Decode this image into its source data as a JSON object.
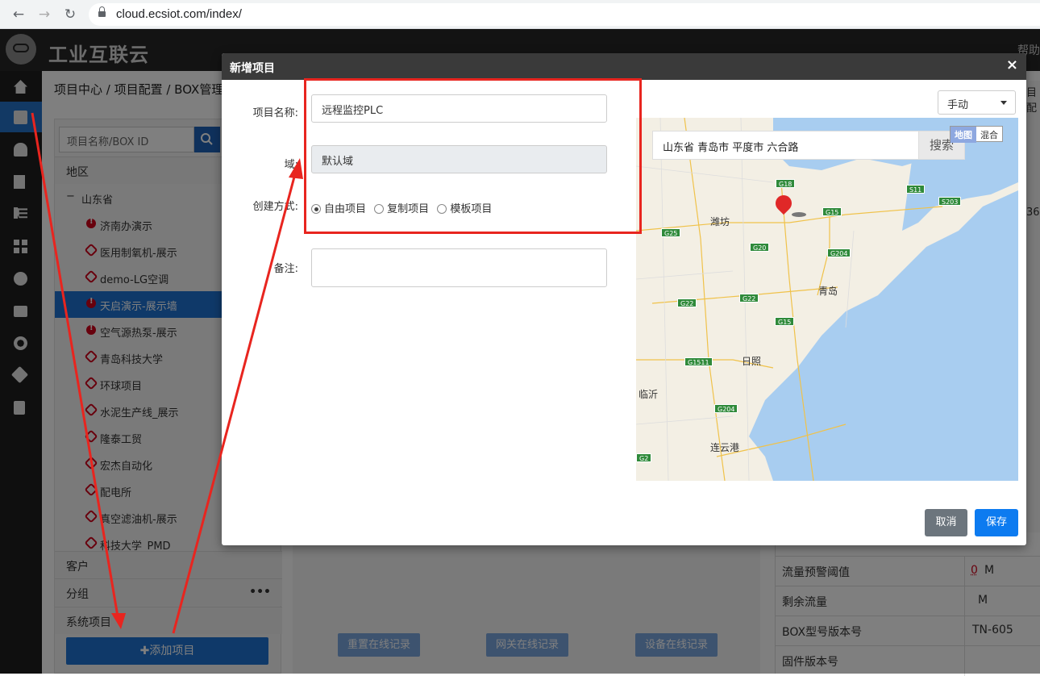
{
  "browser": {
    "back": "←",
    "forward": "→",
    "reload": "↻",
    "url": "cloud.ecsiot.com/index/"
  },
  "header": {
    "app_title": "工业互联云",
    "help": "帮助"
  },
  "sidebar_icons": [
    "home-icon",
    "box-icon",
    "bell-icon",
    "book-icon",
    "tools-icon",
    "grid-icon",
    "bug-icon",
    "briefcase-icon",
    "share-icon",
    "monitor-icon",
    "clipboard-icon"
  ],
  "breadcrumb": "项目中心 / 项目配置 / BOX管理",
  "tree": {
    "search_placeholder": "项目名称/BOX ID",
    "section_region": "地区",
    "province": "山东省",
    "items": [
      {
        "label": "济南办演示",
        "icon": "warn"
      },
      {
        "label": "医用制氧机-展示",
        "icon": "link"
      },
      {
        "label": "demo-LG空调",
        "icon": "link"
      },
      {
        "label": "天启演示-展示墙",
        "icon": "warn"
      },
      {
        "label": "空气源热泵-展示",
        "icon": "warn"
      },
      {
        "label": "青岛科技大学",
        "icon": "link"
      },
      {
        "label": "环球项目",
        "icon": "link"
      },
      {
        "label": "水泥生产线_展示",
        "icon": "link"
      },
      {
        "label": "隆泰工贸",
        "icon": "link"
      },
      {
        "label": "宏杰自动化",
        "icon": "link"
      },
      {
        "label": "配电所",
        "icon": "link"
      },
      {
        "label": "真空滤油机-展示",
        "icon": "link"
      },
      {
        "label": "科技大学_PMD",
        "icon": "link"
      }
    ],
    "section_customer": "客户",
    "section_group": "分组",
    "group_more": "•••",
    "section_system": "系统项目"
  },
  "add_project_button": "✚添加项目",
  "bottom_buttons": {
    "reset": "重置在线记录",
    "gateway": "网关在线记录",
    "device": "设备在线记录"
  },
  "right_table": [
    {
      "key": "流量预警阈值",
      "value": "0",
      "unit": "M"
    },
    {
      "key": "剩余流量",
      "value": "",
      "unit": "M"
    },
    {
      "key": "BOX型号版本号",
      "value": "TN-605",
      "unit": ""
    },
    {
      "key": "固件版本号",
      "value": "",
      "unit": ""
    }
  ],
  "right_peek": {
    "top": "目配",
    "num": "36"
  },
  "modal": {
    "title": "新增项目",
    "close": "×",
    "name_label": "项目名称:",
    "name_value": "远程监控PLC",
    "domain_label": "域:",
    "domain_value": "默认域",
    "create_label": "创建方式:",
    "create_options": [
      "自由项目",
      "复制项目",
      "模板项目"
    ],
    "create_selected": 0,
    "remark_label": "备注:",
    "mode_select": "手动",
    "cancel": "取消",
    "save": "保存"
  },
  "map": {
    "search_text": "山东省  青岛市  平度市  六合路",
    "search_button": "搜索",
    "type_map": "地图",
    "type_hybrid": "混合",
    "cities": [
      "潍坊",
      "青岛",
      "日照",
      "临沂",
      "连云港"
    ],
    "highways": [
      "G18",
      "S11",
      "S203",
      "G15",
      "G25",
      "G20",
      "G204",
      "G22",
      "G22",
      "G15",
      "G1511",
      "G204",
      "G2"
    ]
  },
  "colors": {
    "accent": "#1e73d2",
    "annotation": "#e8251f",
    "header": "#262626"
  }
}
